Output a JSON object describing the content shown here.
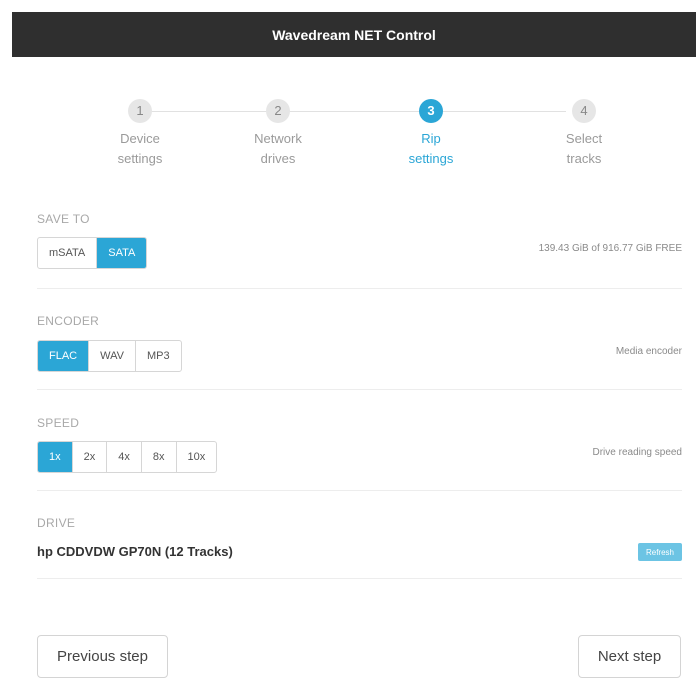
{
  "app": {
    "title": "Wavedream NET Control"
  },
  "stepper": {
    "steps": [
      {
        "number": "1",
        "line1": "Device",
        "line2": "settings"
      },
      {
        "number": "2",
        "line1": "Network",
        "line2": "drives"
      },
      {
        "number": "3",
        "line1": "Rip",
        "line2": "settings"
      },
      {
        "number": "4",
        "line1": "Select",
        "line2": "tracks"
      }
    ],
    "active_step": 3
  },
  "save_to": {
    "title": "SAVE TO",
    "options": [
      "mSATA",
      "SATA"
    ],
    "selected": "SATA",
    "info": "139.43 GiB of 916.77 GiB FREE"
  },
  "encoder": {
    "title": "ENCODER",
    "options": [
      "FLAC",
      "WAV",
      "MP3"
    ],
    "selected": "FLAC",
    "info": "Media encoder"
  },
  "speed": {
    "title": "SPEED",
    "options": [
      "1x",
      "2x",
      "4x",
      "8x",
      "10x"
    ],
    "selected": "1x",
    "info": "Drive reading speed"
  },
  "drive": {
    "title": "DRIVE",
    "name": "hp CDDVDW GP70N (12 Tracks)",
    "refresh_label": "Refresh"
  },
  "footer": {
    "previous_label": "Previous step",
    "next_label": "Next step"
  },
  "colors": {
    "accent": "#2ba6d6",
    "header_bg": "#2f2f2f"
  }
}
